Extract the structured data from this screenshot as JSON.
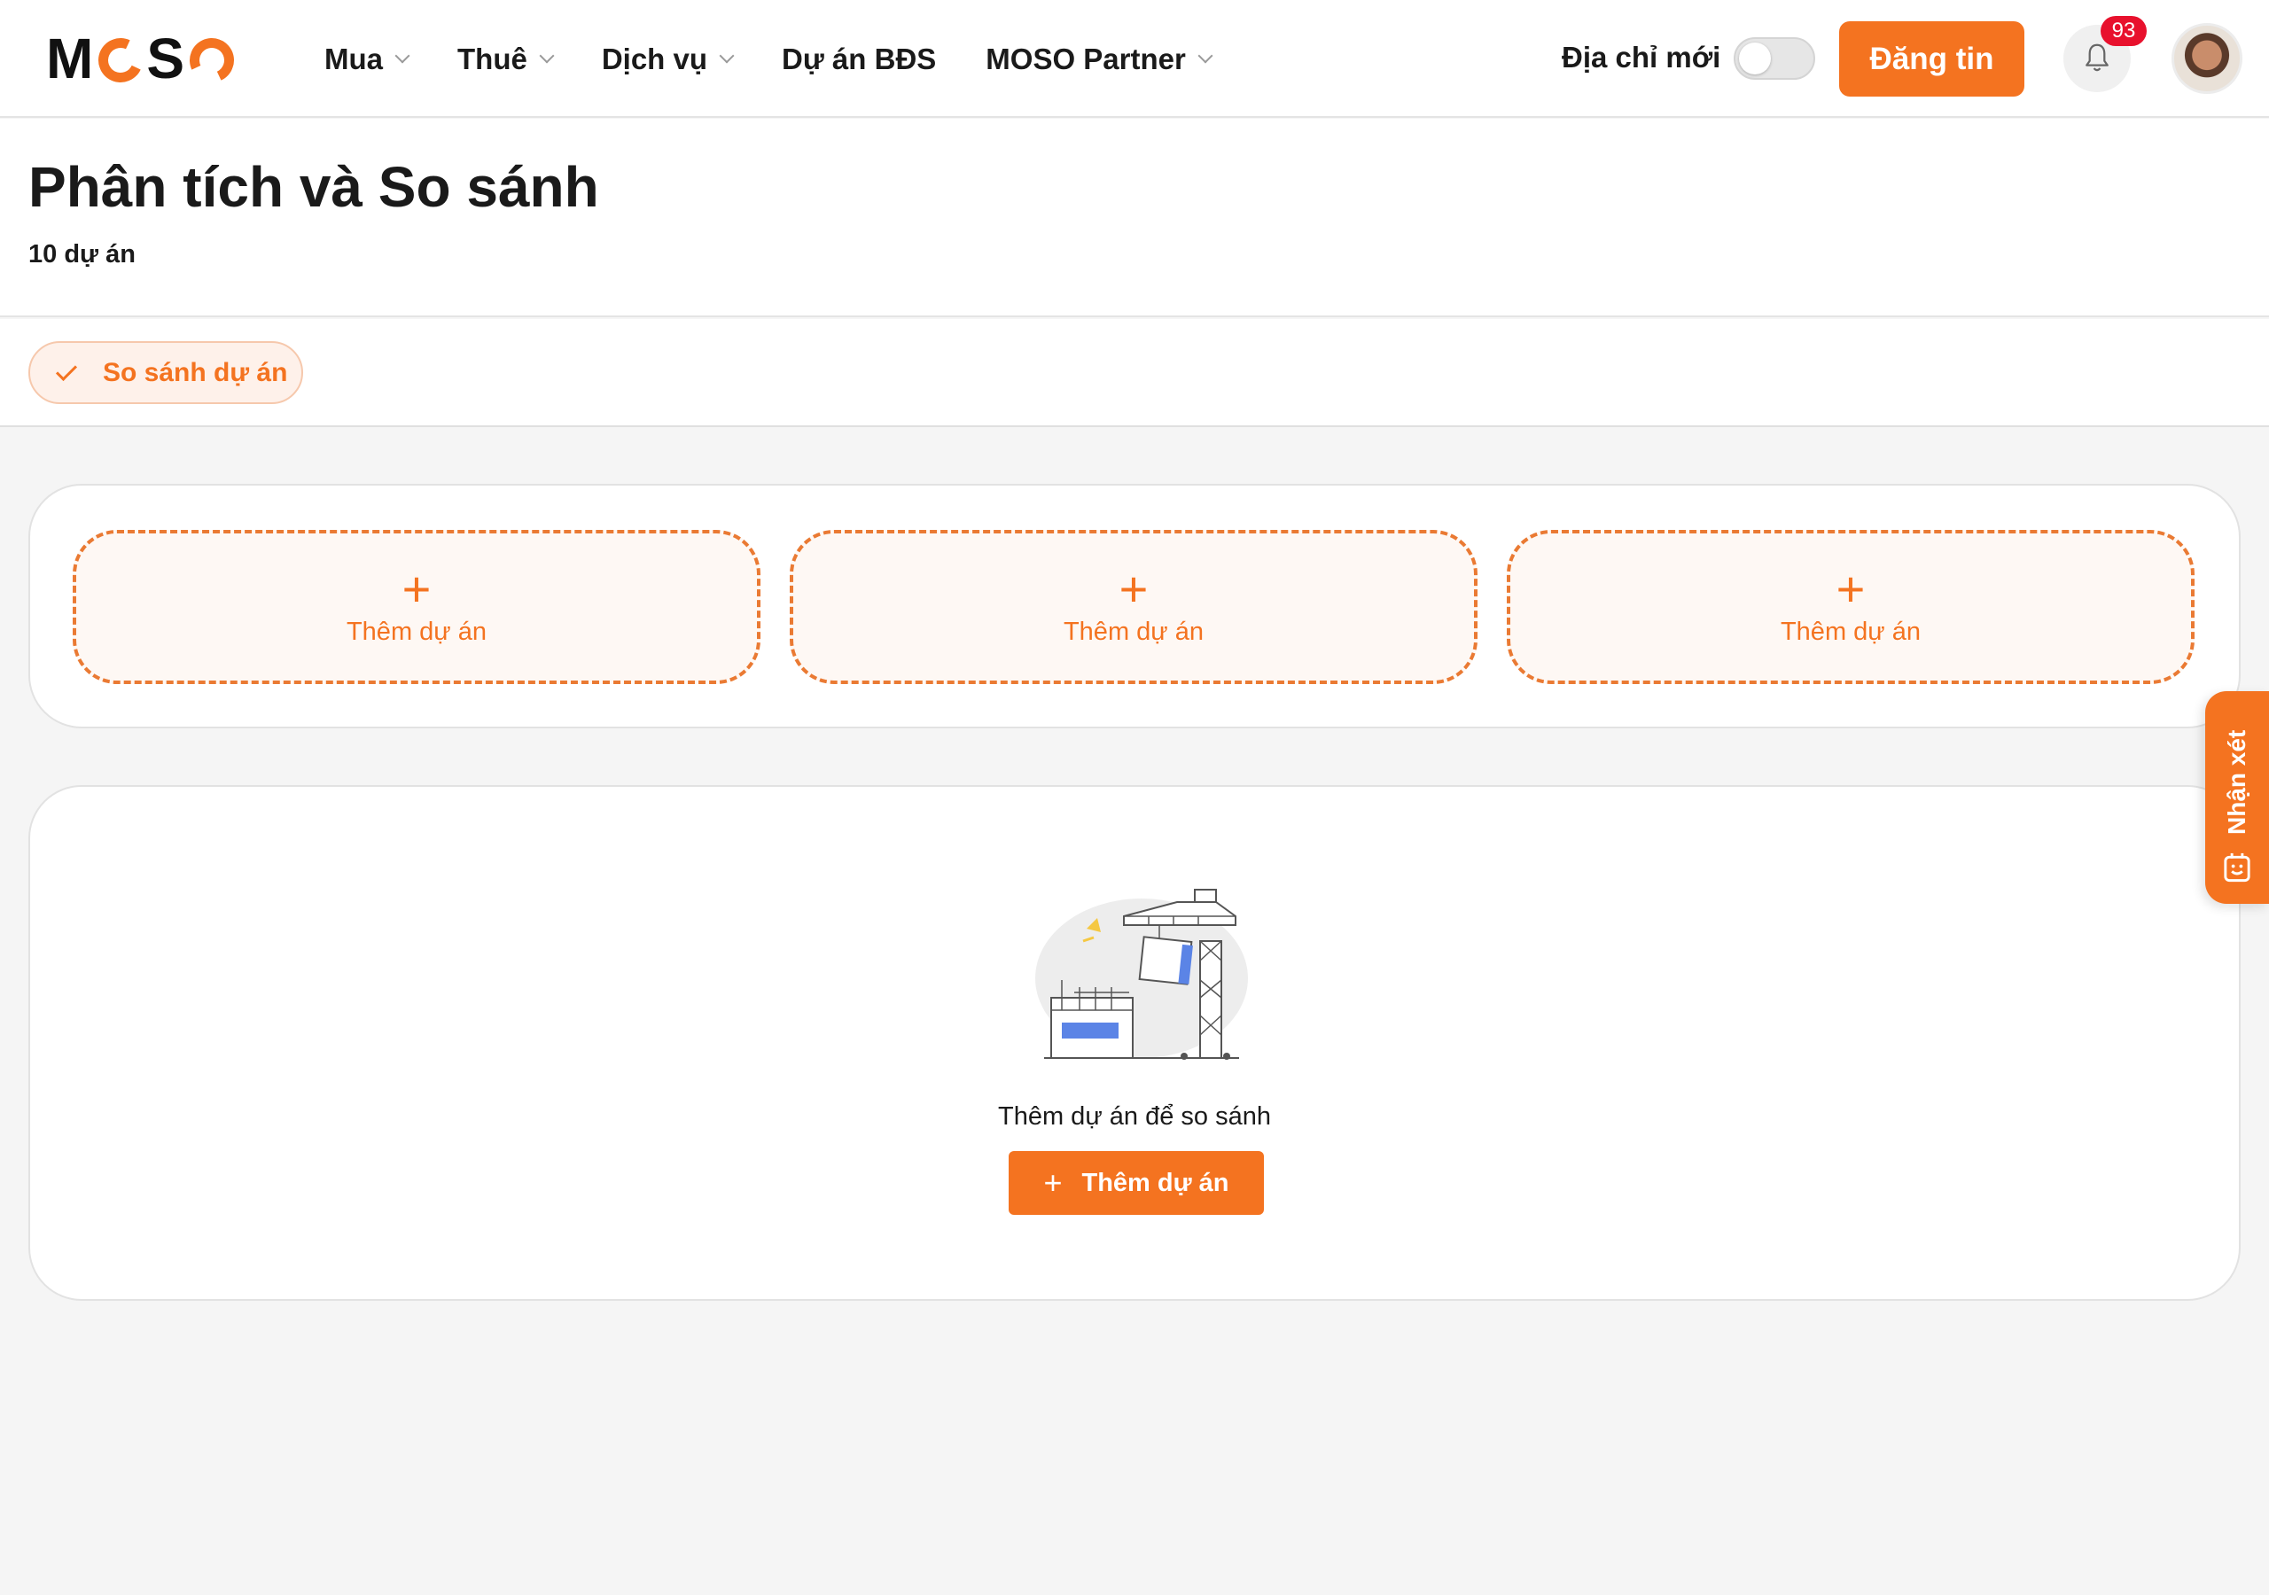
{
  "header": {
    "logo": "MOSO",
    "nav": [
      {
        "label": "Mua",
        "has_dropdown": true
      },
      {
        "label": "Thuê",
        "has_dropdown": true
      },
      {
        "label": "Dịch vụ",
        "has_dropdown": true
      },
      {
        "label": "Dự án BĐS",
        "has_dropdown": false
      },
      {
        "label": "MOSO Partner",
        "has_dropdown": true
      }
    ],
    "new_address_label": "Địa chỉ mới",
    "new_address_toggle": "off",
    "post_button": "Đăng tin",
    "notification_count": "93",
    "bell_icon": "bell-icon",
    "avatar_icon": "user-avatar"
  },
  "page": {
    "title": "Phân tích và So sánh",
    "subtitle": "10 dự án"
  },
  "tabs": {
    "active": "So sánh dự án"
  },
  "slots": [
    {
      "label": "Thêm dự án",
      "icon": "plus-icon"
    },
    {
      "label": "Thêm dự án",
      "icon": "plus-icon"
    },
    {
      "label": "Thêm dự án",
      "icon": "plus-icon"
    }
  ],
  "empty_state": {
    "message": "Thêm dự án để so sánh",
    "button": "Thêm dự án",
    "illustration": "construction-crane-illustration"
  },
  "feedback": {
    "label": "Nhận xét",
    "icon": "feedback-smile-icon"
  },
  "colors": {
    "accent": "#f47320",
    "badge": "#e8112d",
    "background": "#f5f5f5"
  }
}
